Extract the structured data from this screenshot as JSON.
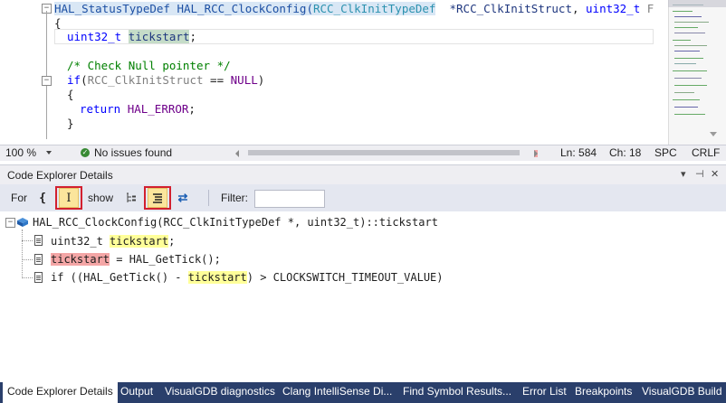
{
  "editor": {
    "line1": {
      "fn": "HAL_StatusTypeDef HAL_RCC_ClockConfig(",
      "type": "RCC_ClkInitTypeDef",
      "param1": "  *RCC_ClkInitStruct",
      "sep": ", ",
      "type2": "uint32_t",
      "param2": " FLatency"
    },
    "line2": "{",
    "line3": {
      "type": "uint32_t",
      "space": " ",
      "var": "tickstart",
      "end": ";"
    },
    "line5": "/* Check Null pointer */",
    "line6": {
      "kw": "if",
      "open": "(",
      "var": "RCC_ClkInitStruct",
      "op": " == ",
      "macro": "NULL",
      "close": ")"
    },
    "line7": "{",
    "line8": {
      "kw": "return",
      "space": " ",
      "val": "HAL_ERROR",
      "end": ";"
    },
    "line9": "}"
  },
  "status": {
    "zoom": "100 %",
    "issues": "No issues found",
    "line": "Ln: 584",
    "col": "Ch: 18",
    "spc": "SPC",
    "eol": "CRLF"
  },
  "tool_window": {
    "title": "Code Explorer Details",
    "pin_icon": "pin-icon",
    "close_icon": "close-icon"
  },
  "toolbar": {
    "for_label": "For",
    "show_label": "show",
    "filter_label": "Filter:",
    "filter_value": "",
    "brace_glyph": "{",
    "ibeam_glyph": "I",
    "refs_glyph": "⇄"
  },
  "tree": {
    "root": "HAL_RCC_ClockConfig(RCC_ClkInitTypeDef *, uint32_t)::tickstart",
    "items": [
      {
        "pre": "uint32_t ",
        "hl": "tickstart",
        "post": ";"
      },
      {
        "pre": "",
        "hl": "tickstart",
        "post": " = HAL_GetTick();"
      },
      {
        "pre": "if ((HAL_GetTick() - ",
        "hl": "tickstart",
        "post": ") > CLOCKSWITCH_TIMEOUT_VALUE)"
      }
    ]
  },
  "tabs": [
    "Code Explorer Details",
    "Output",
    "VisualGDB diagnostics",
    "Clang IntelliSense Di...",
    "Find Symbol Results...",
    "Error List",
    "Breakpoints",
    "VisualGDB Build"
  ],
  "colors": {
    "accent_tabbar": "#2a3f6b",
    "active_button": "#fbe59c",
    "highlight_red_box": "#d2202f",
    "decl_highlight": "#ffff99",
    "write_highlight": "#f4a6a6"
  }
}
